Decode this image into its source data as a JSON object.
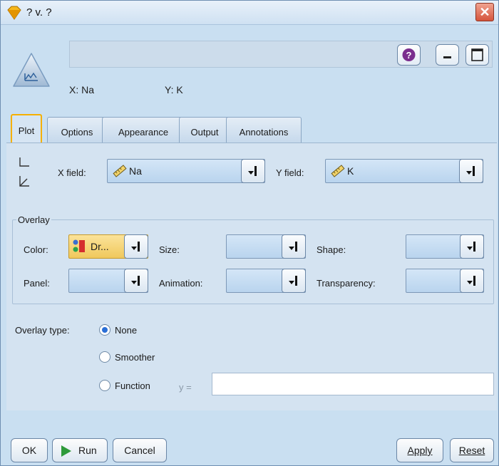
{
  "window": {
    "title": "? v. ?"
  },
  "header": {
    "name_value": "",
    "x_info": "X: Na",
    "y_info": "Y: K"
  },
  "tabs": [
    {
      "label": "Plot",
      "active": true
    },
    {
      "label": "Options",
      "active": false
    },
    {
      "label": "Appearance",
      "active": false
    },
    {
      "label": "Output",
      "active": false
    },
    {
      "label": "Annotations",
      "active": false
    }
  ],
  "fields": {
    "x_label": "X field:",
    "x_value": "Na",
    "y_label": "Y field:",
    "y_value": "K"
  },
  "overlay": {
    "legend": "Overlay",
    "color_label": "Color:",
    "color_value": "Dr...",
    "size_label": "Size:",
    "size_value": "",
    "shape_label": "Shape:",
    "shape_value": "",
    "panel_label": "Panel:",
    "panel_value": "",
    "animation_label": "Animation:",
    "animation_value": "",
    "transparency_label": "Transparency:",
    "transparency_value": ""
  },
  "overlay_type": {
    "label": "Overlay type:",
    "options": [
      "None",
      "Smoother",
      "Function"
    ],
    "selected": "None",
    "function_prefix": "y =",
    "function_value": ""
  },
  "buttons": {
    "ok": "OK",
    "run": "Run",
    "cancel": "Cancel",
    "apply": "Apply",
    "reset": "Reset"
  },
  "colors": {
    "accent_tab": "#f5b000",
    "run_arrow": "#2e9a3a",
    "help_icon": "#7b2e8e"
  }
}
